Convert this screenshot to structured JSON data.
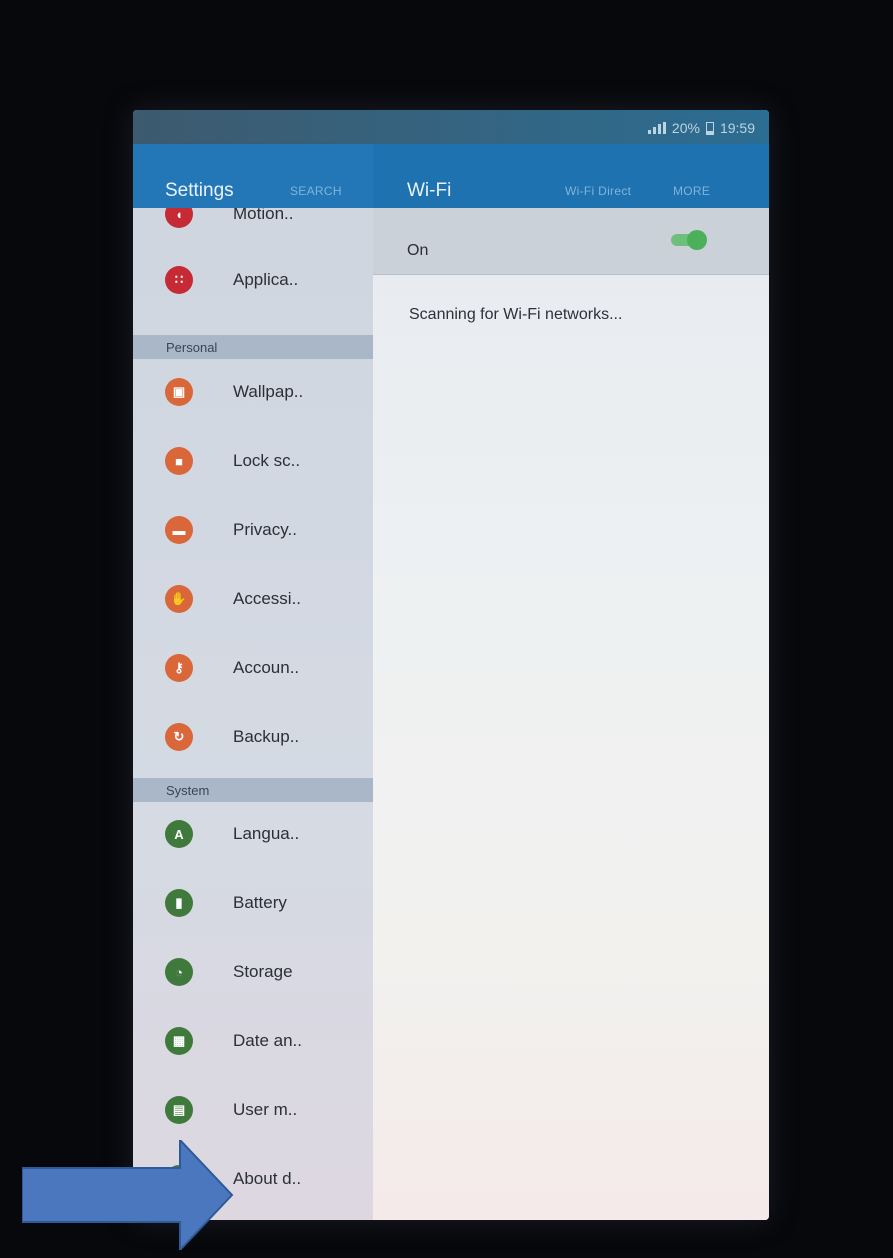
{
  "status_bar": {
    "battery": "20%",
    "time": "19:59"
  },
  "left_header": {
    "title": "Settings",
    "search_label": "SEARCH"
  },
  "right_header": {
    "title": "Wi-Fi",
    "wifi_direct_label": "Wi-Fi Direct",
    "more_label": "MORE"
  },
  "menu": {
    "items_top": [
      {
        "label": "Motion..",
        "icon": "motion-icon",
        "color": "#c62a35",
        "glyph": "◖"
      },
      {
        "label": "Applica..",
        "icon": "apps-grid-icon",
        "color": "#c62a35",
        "glyph": "∷"
      }
    ],
    "personal_header": "Personal",
    "items_personal": [
      {
        "label": "Wallpap..",
        "icon": "wallpaper-icon",
        "color": "#d9673a",
        "glyph": "▣"
      },
      {
        "label": "Lock sc..",
        "icon": "lock-icon",
        "color": "#d9673a",
        "glyph": "■"
      },
      {
        "label": "Privacy..",
        "icon": "privacy-icon",
        "color": "#d9673a",
        "glyph": "▬"
      },
      {
        "label": "Accessi..",
        "icon": "accessibility-icon",
        "color": "#d9673a",
        "glyph": "✋"
      },
      {
        "label": "Accoun..",
        "icon": "key-icon",
        "color": "#d9673a",
        "glyph": "⚷"
      },
      {
        "label": "Backup..",
        "icon": "backup-icon",
        "color": "#d9673a",
        "glyph": "↻"
      }
    ],
    "system_header": "System",
    "items_system": [
      {
        "label": "Langua..",
        "icon": "language-icon",
        "color": "#3f7a3c",
        "glyph": "A"
      },
      {
        "label": "Battery",
        "icon": "battery-icon",
        "color": "#3f7a3c",
        "glyph": "▮"
      },
      {
        "label": "Storage",
        "icon": "storage-icon",
        "color": "#3f7a3c",
        "glyph": "◔"
      },
      {
        "label": "Date an..",
        "icon": "calendar-icon",
        "color": "#3f7a3c",
        "glyph": "▦"
      },
      {
        "label": "User m..",
        "icon": "manual-icon",
        "color": "#3f7a3c",
        "glyph": "▤"
      },
      {
        "label": "About d..",
        "icon": "info-icon",
        "color": "#3f7a3c",
        "glyph": "i"
      }
    ]
  },
  "wifi": {
    "switch_label": "On",
    "switch_on": true,
    "status_text": "Scanning for Wi-Fi networks..."
  },
  "annotation": {
    "arrow_color": "#4a77bd"
  }
}
